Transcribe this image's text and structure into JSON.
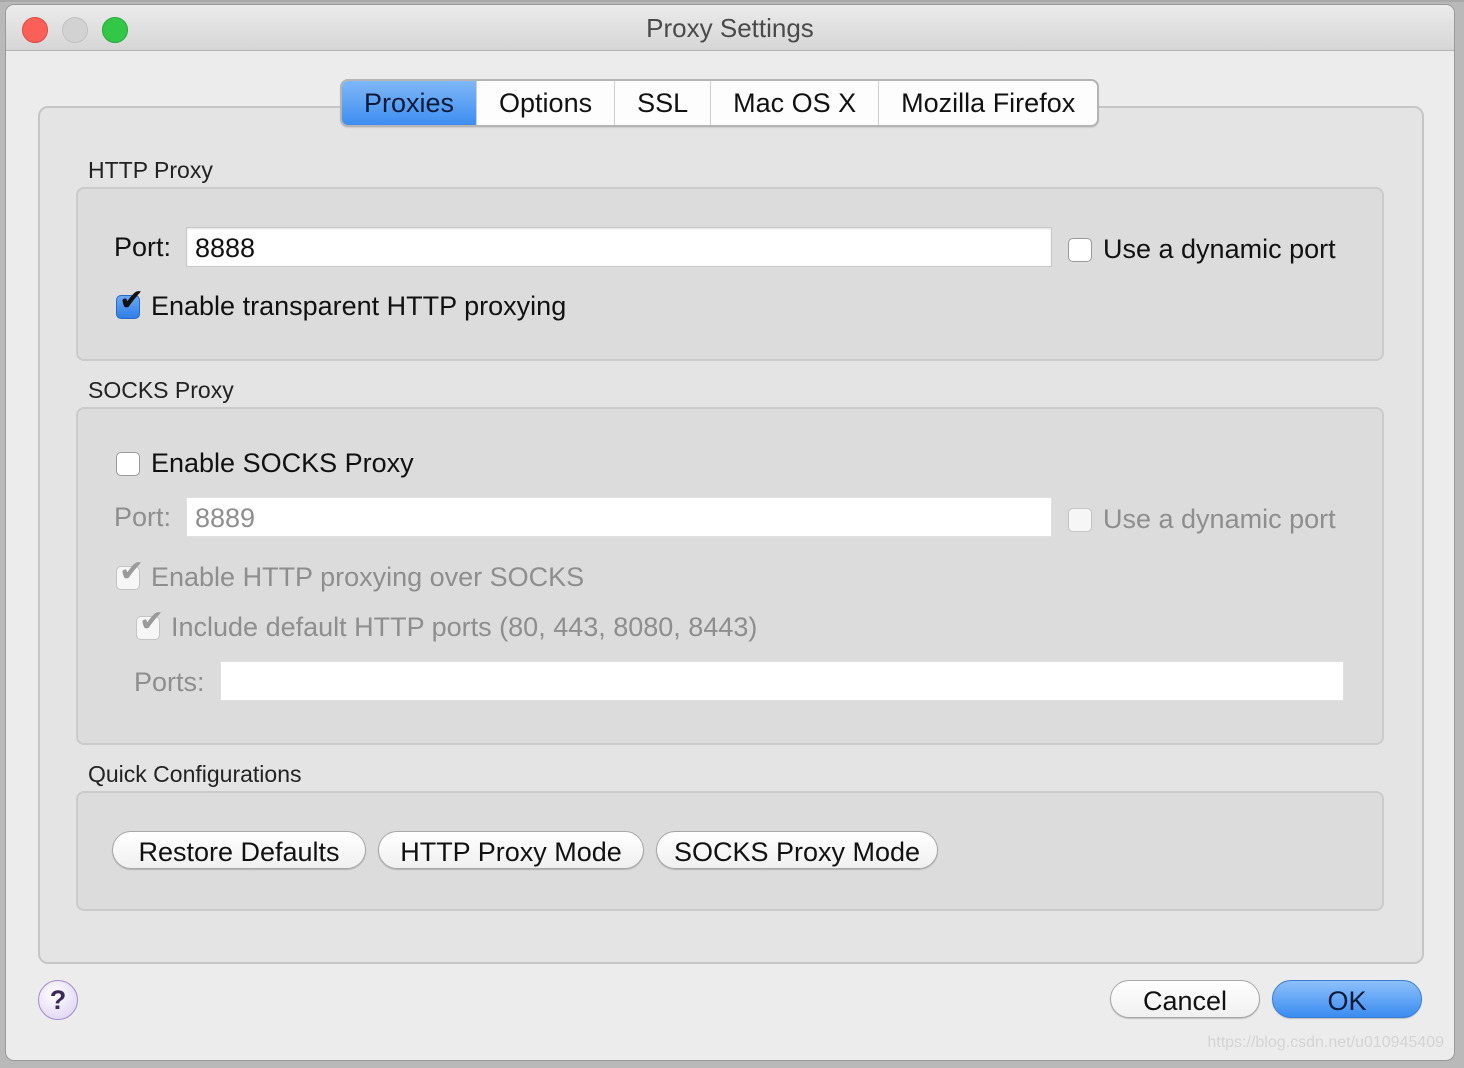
{
  "window": {
    "title": "Proxy Settings"
  },
  "tabs": [
    {
      "label": "Proxies",
      "active": true
    },
    {
      "label": "Options",
      "active": false
    },
    {
      "label": "SSL",
      "active": false
    },
    {
      "label": "Mac OS X",
      "active": false
    },
    {
      "label": "Mozilla Firefox",
      "active": false
    }
  ],
  "http_proxy": {
    "group_label": "HTTP Proxy",
    "port_label": "Port:",
    "port_value": "8888",
    "dynamic_port_label": "Use a dynamic port",
    "dynamic_port_checked": false,
    "transparent_label": "Enable transparent HTTP proxying",
    "transparent_checked": true
  },
  "socks_proxy": {
    "group_label": "SOCKS Proxy",
    "enable_label": "Enable SOCKS Proxy",
    "enable_checked": false,
    "port_label": "Port:",
    "port_value": "8889",
    "dynamic_port_label": "Use a dynamic port",
    "http_over_socks_label": "Enable HTTP proxying over SOCKS",
    "include_default_ports_label": "Include default HTTP ports (80, 443, 8080, 8443)",
    "ports_label": "Ports:",
    "ports_value": ""
  },
  "quick_config": {
    "group_label": "Quick Configurations",
    "restore_defaults": "Restore Defaults",
    "http_proxy_mode": "HTTP Proxy Mode",
    "socks_proxy_mode": "SOCKS Proxy Mode"
  },
  "footer": {
    "help": "?",
    "cancel": "Cancel",
    "ok": "OK",
    "watermark": "https://blog.csdn.net/u010945409"
  },
  "colors": {
    "accent": "#3d8ef0",
    "window_bg": "#ececec"
  }
}
